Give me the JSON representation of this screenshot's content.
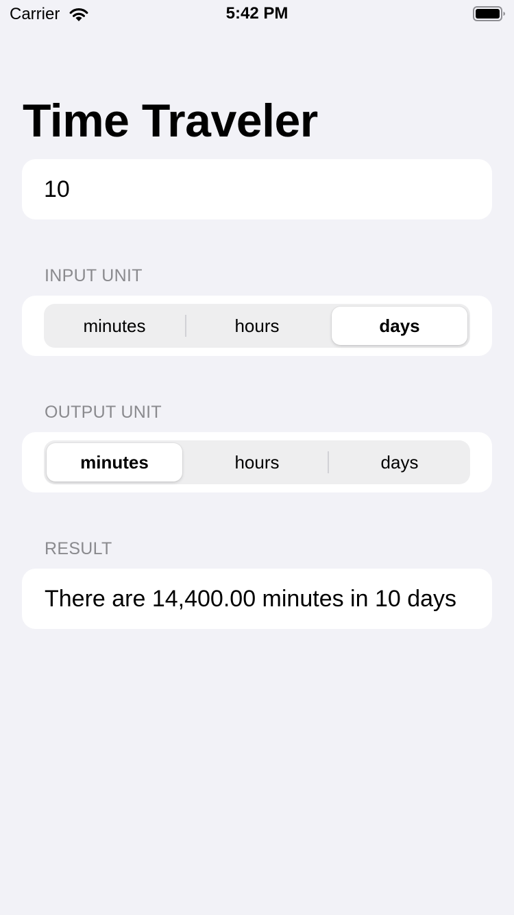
{
  "status_bar": {
    "carrier": "Carrier",
    "time": "5:42 PM",
    "wifi_icon": "wifi-icon",
    "battery_icon": "battery-icon"
  },
  "title": "Time Traveler",
  "amount": {
    "value": "10",
    "placeholder": ""
  },
  "input_unit": {
    "header": "INPUT UNIT",
    "options": [
      "minutes",
      "hours",
      "days"
    ],
    "selected": "days"
  },
  "output_unit": {
    "header": "OUTPUT UNIT",
    "options": [
      "minutes",
      "hours",
      "days"
    ],
    "selected": "minutes"
  },
  "result": {
    "header": "RESULT",
    "text": "There are 14,400.00 minutes in 10 days"
  },
  "colors": {
    "background": "#f2f2f7",
    "card": "#ffffff",
    "section_header": "#8a8a8e",
    "segment_track": "#eeeeef"
  }
}
